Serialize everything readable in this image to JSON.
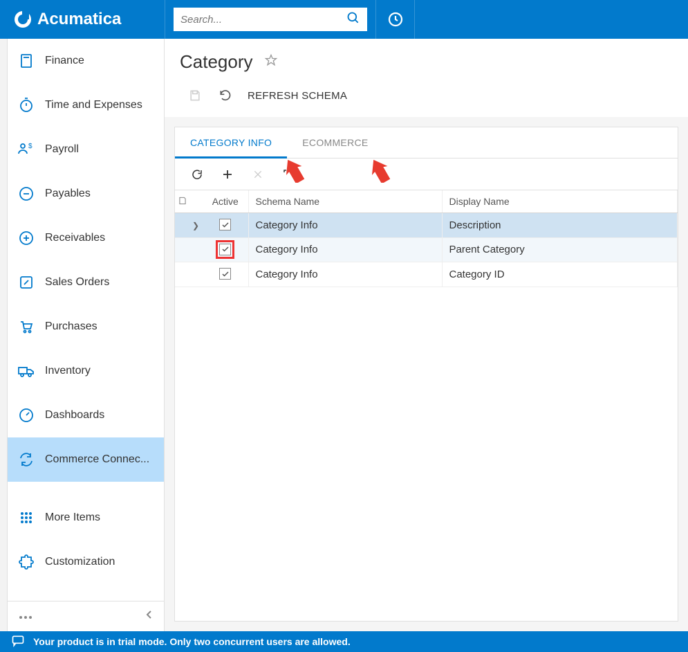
{
  "brand": "Acumatica",
  "search": {
    "placeholder": "Search..."
  },
  "sidebar": {
    "items": [
      {
        "label": "Finance",
        "icon": "calculator-icon"
      },
      {
        "label": "Time and Expenses",
        "icon": "stopwatch-icon"
      },
      {
        "label": "Payroll",
        "icon": "payroll-icon"
      },
      {
        "label": "Payables",
        "icon": "minus-circle-icon"
      },
      {
        "label": "Receivables",
        "icon": "plus-circle-icon"
      },
      {
        "label": "Sales Orders",
        "icon": "edit-square-icon"
      },
      {
        "label": "Purchases",
        "icon": "cart-icon"
      },
      {
        "label": "Inventory",
        "icon": "truck-icon"
      },
      {
        "label": "Dashboards",
        "icon": "gauge-icon"
      },
      {
        "label": "Commerce Connec...",
        "icon": "sync-icon"
      }
    ],
    "extra": [
      {
        "label": "More Items",
        "icon": "grid-dots-icon"
      },
      {
        "label": "Customization",
        "icon": "puzzle-icon"
      }
    ]
  },
  "page": {
    "title": "Category",
    "toolbar": {
      "refresh_label": "REFRESH SCHEMA"
    },
    "tabs": [
      {
        "label": "CATEGORY INFO"
      },
      {
        "label": "ECOMMERCE"
      }
    ],
    "columns": {
      "active": "Active",
      "schema": "Schema Name",
      "display": "Display Name"
    },
    "rows": [
      {
        "active": true,
        "schema": "Category Info",
        "display": "Description",
        "selected": true,
        "highlight": false
      },
      {
        "active": true,
        "schema": "Category Info",
        "display": "Parent Category",
        "selected": false,
        "highlight": true
      },
      {
        "active": true,
        "schema": "Category Info",
        "display": "Category ID",
        "selected": false,
        "highlight": false
      }
    ]
  },
  "status": {
    "text": "Your product is in trial mode. Only two concurrent users are allowed."
  },
  "colors": {
    "primary": "#027acc",
    "sidebar_active": "#b7ddfb",
    "highlight": "#e33"
  }
}
